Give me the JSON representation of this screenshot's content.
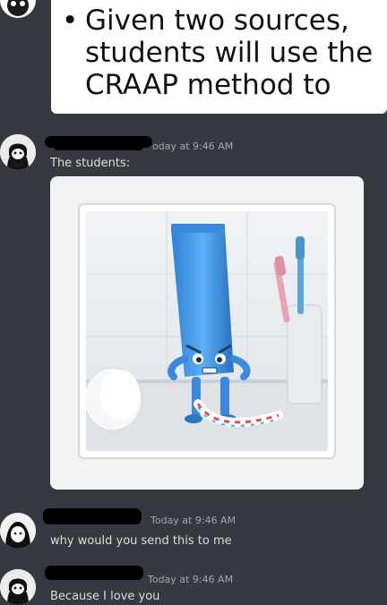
{
  "top_message": {
    "slide": {
      "bullet": "•",
      "text": "Given two sources,\nstudents will use the\nCRAAP method to"
    }
  },
  "messages": [
    {
      "timestamp": "oday at 9:46 AM",
      "text": "The students:",
      "attachment_icon": "angry-toothpaste-tube-image"
    },
    {
      "timestamp": "Today at 9:46 AM",
      "text": "why would you send this to me"
    },
    {
      "timestamp": "Today at 9:46 AM",
      "text": "Because I love you"
    }
  ],
  "colors": {
    "background": "#36393f",
    "message_text": "#dcddde",
    "timestamp": "#a3a6aa",
    "redaction": "#000000"
  }
}
